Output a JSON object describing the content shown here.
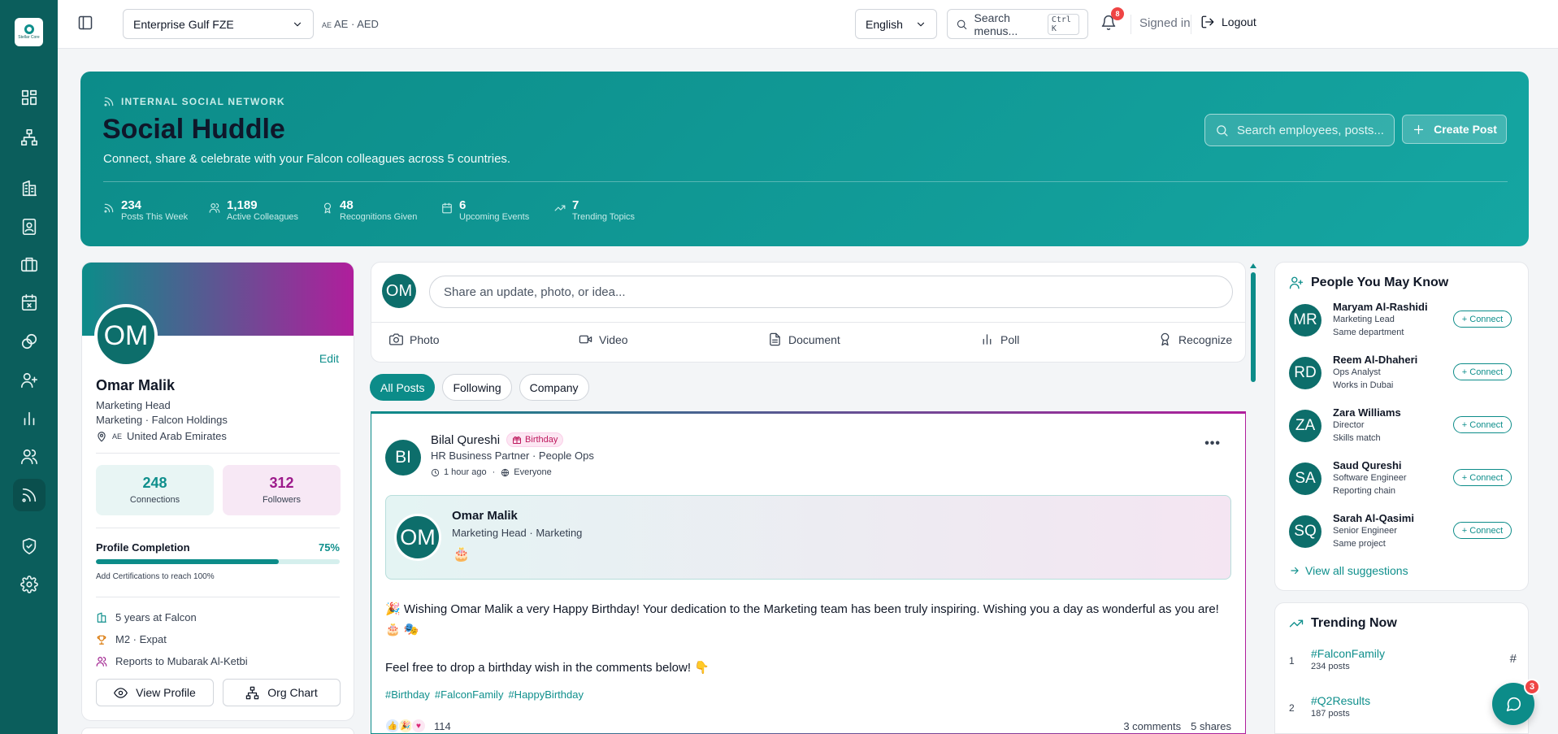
{
  "app": {
    "logo_text": "Stellar Core"
  },
  "topbar": {
    "company": "Enterprise Gulf FZE",
    "currency_flag": "AE",
    "currency": "AE · AED",
    "language": "English",
    "search_placeholder": "Search menus...",
    "search_shortcut": "Ctrl K",
    "notifications_count": "8",
    "signed_in": "Signed in",
    "logout": "Logout"
  },
  "hero": {
    "tag": "INTERNAL SOCIAL NETWORK",
    "title": "Social Huddle",
    "subtitle": "Connect, share & celebrate with your Falcon colleagues across 5 countries.",
    "search_placeholder": "Search employees, posts...",
    "create_label": "Create Post",
    "stats": [
      {
        "value": "234",
        "label": "Posts This Week",
        "icon": "rss-icon"
      },
      {
        "value": "1,189",
        "label": "Active Colleagues",
        "icon": "users-icon"
      },
      {
        "value": "48",
        "label": "Recognitions Given",
        "icon": "award-icon"
      },
      {
        "value": "6",
        "label": "Upcoming Events",
        "icon": "calendar-icon"
      },
      {
        "value": "7",
        "label": "Trending Topics",
        "icon": "trending-icon"
      }
    ]
  },
  "profile": {
    "initials": "OM",
    "edit": "Edit",
    "name": "Omar Malik",
    "title": "Marketing Head",
    "dept": "Marketing · Falcon Holdings",
    "location_flag": "AE",
    "location": "United Arab Emirates",
    "connections_value": "248",
    "connections_label": "Connections",
    "followers_value": "312",
    "followers_label": "Followers",
    "completion_label": "Profile Completion",
    "completion_pct": "75%",
    "completion_fraction": 0.75,
    "completion_hint": "Add Certifications to reach 100%",
    "facts": [
      "5 years at Falcon",
      "M2 · Expat",
      "Reports to Mubarak Al-Ketbi"
    ],
    "view_profile": "View Profile",
    "org_chart": "Org Chart"
  },
  "composer": {
    "initials": "OM",
    "placeholder": "Share an update, photo, or idea...",
    "actions": [
      "Photo",
      "Video",
      "Document",
      "Poll",
      "Recognize"
    ]
  },
  "feed_tabs": [
    "All Posts",
    "Following",
    "Company"
  ],
  "post": {
    "initials": "BI",
    "author": "Bilal Qureshi",
    "badge": "Birthday",
    "role": "HR Business Partner · People Ops",
    "time": "1 hour ago",
    "audience": "Everyone",
    "card_initials": "OM",
    "card_name": "Omar Malik",
    "card_role": "Marketing Head · Marketing",
    "card_emoji": "🎂",
    "body": "🎉 Wishing Omar Malik a very Happy Birthday! Your dedication to the Marketing team has been truly inspiring. Wishing you a day as wonderful as you are! 🎂 🎭",
    "body2": "Feel free to drop a birthday wish in the comments below! 👇",
    "tags": [
      "#Birthday",
      "#FalconFamily",
      "#HappyBirthday"
    ],
    "reactions": "114",
    "comments": "3 comments",
    "shares": "5 shares"
  },
  "pymk": {
    "title": "People You May Know",
    "people": [
      {
        "initials": "MR",
        "name": "Maryam Al-Rashidi",
        "role": "Marketing Lead",
        "reason": "Same department"
      },
      {
        "initials": "RD",
        "name": "Reem Al-Dhaheri",
        "role": "Ops Analyst",
        "reason": "Works in Dubai"
      },
      {
        "initials": "ZA",
        "name": "Zara Williams",
        "role": "Director",
        "reason": "Skills match"
      },
      {
        "initials": "SA",
        "name": "Saud Qureshi",
        "role": "Software Engineer",
        "reason": "Reporting chain"
      },
      {
        "initials": "SQ",
        "name": "Sarah Al-Qasimi",
        "role": "Senior Engineer",
        "reason": "Same project"
      }
    ],
    "connect_label": "+ Connect",
    "view_all": "View all suggestions"
  },
  "trending": {
    "title": "Trending Now",
    "items": [
      {
        "rank": "1",
        "tag": "#FalconFamily",
        "count": "234 posts"
      },
      {
        "rank": "2",
        "tag": "#Q2Results",
        "count": "187 posts"
      }
    ]
  },
  "chat": {
    "badge": "3"
  }
}
